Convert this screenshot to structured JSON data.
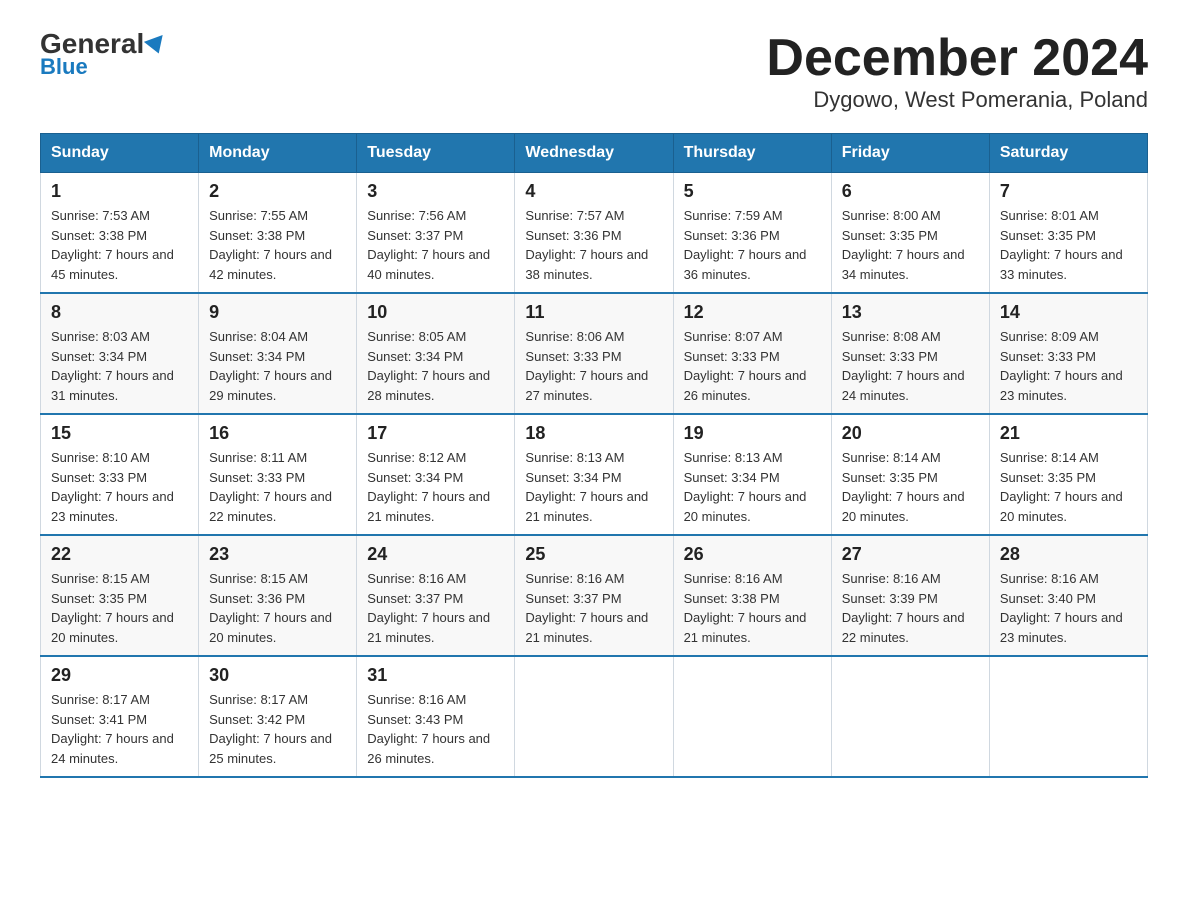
{
  "header": {
    "logo_general": "General",
    "logo_blue": "Blue",
    "title": "December 2024",
    "subtitle": "Dygowo, West Pomerania, Poland"
  },
  "days_of_week": [
    "Sunday",
    "Monday",
    "Tuesday",
    "Wednesday",
    "Thursday",
    "Friday",
    "Saturday"
  ],
  "weeks": [
    [
      {
        "day": "1",
        "sunrise": "7:53 AM",
        "sunset": "3:38 PM",
        "daylight": "7 hours and 45 minutes."
      },
      {
        "day": "2",
        "sunrise": "7:55 AM",
        "sunset": "3:38 PM",
        "daylight": "7 hours and 42 minutes."
      },
      {
        "day": "3",
        "sunrise": "7:56 AM",
        "sunset": "3:37 PM",
        "daylight": "7 hours and 40 minutes."
      },
      {
        "day": "4",
        "sunrise": "7:57 AM",
        "sunset": "3:36 PM",
        "daylight": "7 hours and 38 minutes."
      },
      {
        "day": "5",
        "sunrise": "7:59 AM",
        "sunset": "3:36 PM",
        "daylight": "7 hours and 36 minutes."
      },
      {
        "day": "6",
        "sunrise": "8:00 AM",
        "sunset": "3:35 PM",
        "daylight": "7 hours and 34 minutes."
      },
      {
        "day": "7",
        "sunrise": "8:01 AM",
        "sunset": "3:35 PM",
        "daylight": "7 hours and 33 minutes."
      }
    ],
    [
      {
        "day": "8",
        "sunrise": "8:03 AM",
        "sunset": "3:34 PM",
        "daylight": "7 hours and 31 minutes."
      },
      {
        "day": "9",
        "sunrise": "8:04 AM",
        "sunset": "3:34 PM",
        "daylight": "7 hours and 29 minutes."
      },
      {
        "day": "10",
        "sunrise": "8:05 AM",
        "sunset": "3:34 PM",
        "daylight": "7 hours and 28 minutes."
      },
      {
        "day": "11",
        "sunrise": "8:06 AM",
        "sunset": "3:33 PM",
        "daylight": "7 hours and 27 minutes."
      },
      {
        "day": "12",
        "sunrise": "8:07 AM",
        "sunset": "3:33 PM",
        "daylight": "7 hours and 26 minutes."
      },
      {
        "day": "13",
        "sunrise": "8:08 AM",
        "sunset": "3:33 PM",
        "daylight": "7 hours and 24 minutes."
      },
      {
        "day": "14",
        "sunrise": "8:09 AM",
        "sunset": "3:33 PM",
        "daylight": "7 hours and 23 minutes."
      }
    ],
    [
      {
        "day": "15",
        "sunrise": "8:10 AM",
        "sunset": "3:33 PM",
        "daylight": "7 hours and 23 minutes."
      },
      {
        "day": "16",
        "sunrise": "8:11 AM",
        "sunset": "3:33 PM",
        "daylight": "7 hours and 22 minutes."
      },
      {
        "day": "17",
        "sunrise": "8:12 AM",
        "sunset": "3:34 PM",
        "daylight": "7 hours and 21 minutes."
      },
      {
        "day": "18",
        "sunrise": "8:13 AM",
        "sunset": "3:34 PM",
        "daylight": "7 hours and 21 minutes."
      },
      {
        "day": "19",
        "sunrise": "8:13 AM",
        "sunset": "3:34 PM",
        "daylight": "7 hours and 20 minutes."
      },
      {
        "day": "20",
        "sunrise": "8:14 AM",
        "sunset": "3:35 PM",
        "daylight": "7 hours and 20 minutes."
      },
      {
        "day": "21",
        "sunrise": "8:14 AM",
        "sunset": "3:35 PM",
        "daylight": "7 hours and 20 minutes."
      }
    ],
    [
      {
        "day": "22",
        "sunrise": "8:15 AM",
        "sunset": "3:35 PM",
        "daylight": "7 hours and 20 minutes."
      },
      {
        "day": "23",
        "sunrise": "8:15 AM",
        "sunset": "3:36 PM",
        "daylight": "7 hours and 20 minutes."
      },
      {
        "day": "24",
        "sunrise": "8:16 AM",
        "sunset": "3:37 PM",
        "daylight": "7 hours and 21 minutes."
      },
      {
        "day": "25",
        "sunrise": "8:16 AM",
        "sunset": "3:37 PM",
        "daylight": "7 hours and 21 minutes."
      },
      {
        "day": "26",
        "sunrise": "8:16 AM",
        "sunset": "3:38 PM",
        "daylight": "7 hours and 21 minutes."
      },
      {
        "day": "27",
        "sunrise": "8:16 AM",
        "sunset": "3:39 PM",
        "daylight": "7 hours and 22 minutes."
      },
      {
        "day": "28",
        "sunrise": "8:16 AM",
        "sunset": "3:40 PM",
        "daylight": "7 hours and 23 minutes."
      }
    ],
    [
      {
        "day": "29",
        "sunrise": "8:17 AM",
        "sunset": "3:41 PM",
        "daylight": "7 hours and 24 minutes."
      },
      {
        "day": "30",
        "sunrise": "8:17 AM",
        "sunset": "3:42 PM",
        "daylight": "7 hours and 25 minutes."
      },
      {
        "day": "31",
        "sunrise": "8:16 AM",
        "sunset": "3:43 PM",
        "daylight": "7 hours and 26 minutes."
      },
      null,
      null,
      null,
      null
    ]
  ]
}
